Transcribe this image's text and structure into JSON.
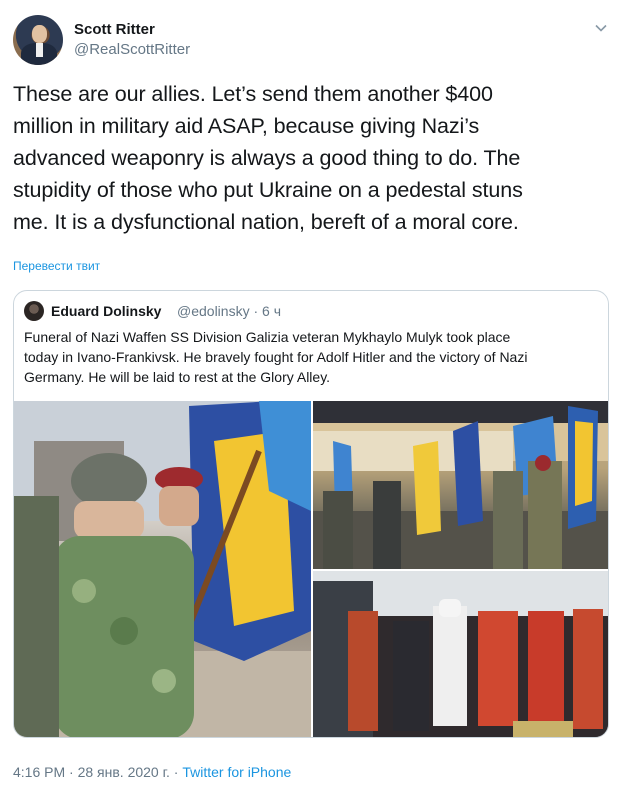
{
  "author": {
    "name": "Scott Ritter",
    "handle": "@RealScottRitter"
  },
  "tweet": {
    "lines": [
      "These are our allies. Let’s send them another $400",
      "million in military aid ASAP, because giving Nazi’s",
      "advanced weaponry is always a good thing to do. The",
      "stupidity of those who put Ukraine on a pedestal stuns",
      "me. It is a dysfunctional nation, bereft of a moral core."
    ],
    "translate_label": "Перевести твит",
    "timestamp": "4:16 PM · 28 янв. 2020 г. · ",
    "source": "Twitter for iPhone"
  },
  "quoted": {
    "name": "Eduard Dolinsky",
    "handle_time": "@edolinsky · 6 ч",
    "lines": [
      "Funeral of Nazi Waffen SS Division Galizia veteran Mykhaylo Mulyk took place",
      "today in Ivano-Frankivsk. He bravely fought for Adolf Hitler and the victory of Nazi",
      "Germany. He will be laid to rest at the Glory Alley."
    ],
    "photos": [
      "ceremony-photo-soldiers-flags",
      "ceremony-photo-building-flags",
      "ceremony-photo-clergy-crowd"
    ]
  },
  "icons": {
    "caret": "chevron-down-icon",
    "accent": "#1b95e0"
  }
}
